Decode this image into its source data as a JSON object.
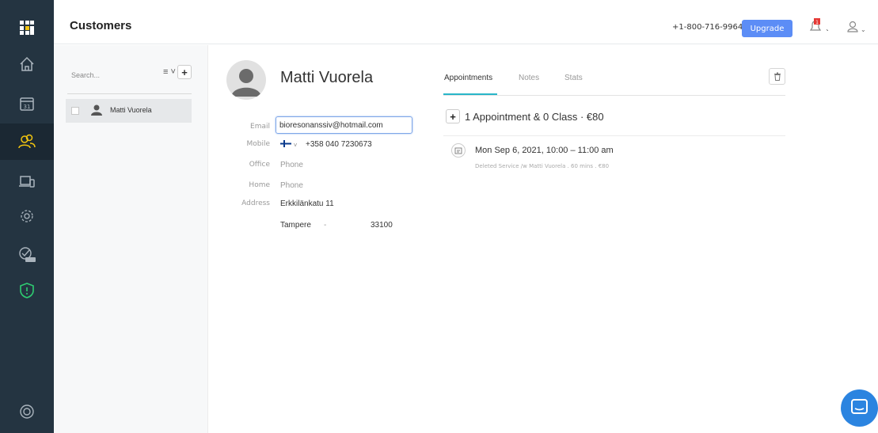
{
  "header": {
    "title": "Customers",
    "phone": "+1-800-716-9964",
    "upgrade_label": "Upgrade",
    "notification_count": "1"
  },
  "sidebar": {
    "items": [
      {
        "name": "logo",
        "icon": "grid-logo-icon"
      },
      {
        "name": "home",
        "icon": "home-icon"
      },
      {
        "name": "calendar",
        "icon": "calendar-icon",
        "badge": "31"
      },
      {
        "name": "customers",
        "icon": "customers-icon",
        "active": true
      },
      {
        "name": "devices",
        "icon": "devices-icon"
      },
      {
        "name": "settings",
        "icon": "gear-icon"
      },
      {
        "name": "beta",
        "icon": "check-beta-icon",
        "badge": "BETA"
      },
      {
        "name": "security",
        "icon": "shield-icon"
      },
      {
        "name": "help",
        "icon": "lifebuoy-icon"
      }
    ]
  },
  "list": {
    "search_placeholder": "Search...",
    "customers": [
      "Matti Vuorela"
    ]
  },
  "profile": {
    "name": "Matti Vuorela",
    "fields": {
      "email_label": "Email",
      "email": "bioresonanssiv@hotmail.com",
      "mobile_label": "Mobile",
      "mobile": "+358 040 7230673",
      "office_label": "Office",
      "office_placeholder": "Phone",
      "home_label": "Home",
      "home_placeholder": "Phone",
      "address_label": "Address",
      "street": "Erkkilänkatu 11",
      "city": "Tampere",
      "separator": "-",
      "zip": "33100"
    }
  },
  "tabs": [
    "Appointments",
    "Notes",
    "Stats"
  ],
  "appointments": {
    "summary": "1 Appointment & 0 Class · €80",
    "items": [
      {
        "date": "Mon Sep 6, 2021, 10:00 – 11:00 am",
        "details": "Deleted Service /w Matti Vuorela . 60 mins . €80"
      }
    ]
  },
  "colors": {
    "sidebar_bg": "#243441",
    "accent": "#5c8df6",
    "tab_underline": "#29b6c9",
    "shield": "#2ecc71",
    "chat": "#2b84e0"
  }
}
